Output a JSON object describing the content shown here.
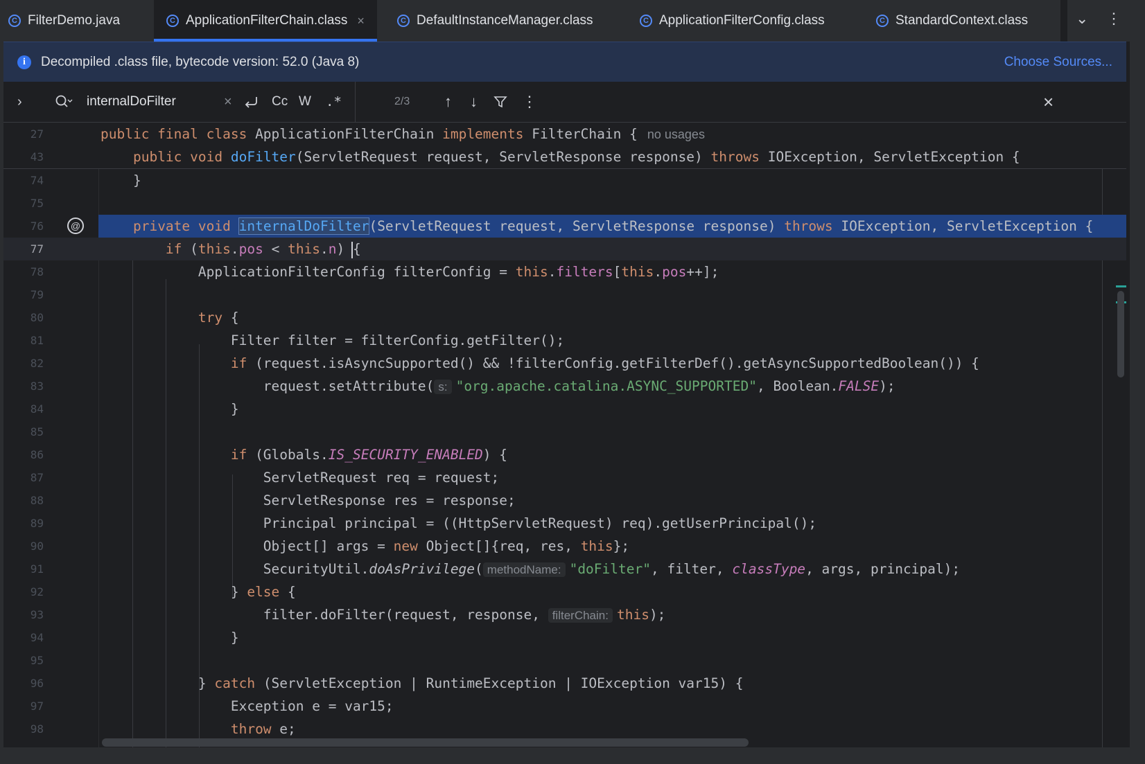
{
  "tabs": [
    {
      "label": "FilterDemo.java",
      "icon": "java-class-icon",
      "active": false
    },
    {
      "label": "ApplicationFilterChain.class",
      "icon": "class-file-icon",
      "active": true
    },
    {
      "label": "DefaultInstanceManager.class",
      "icon": "class-icon",
      "active": false
    },
    {
      "label": "ApplicationFilterConfig.class",
      "icon": "class-file-icon",
      "active": false
    },
    {
      "label": "StandardContext.class",
      "icon": "class-icon",
      "active": false
    }
  ],
  "tab_close": "×",
  "banner": {
    "message": "Decompiled .class file, bytecode version: 52.0 (Java 8)",
    "link": "Choose Sources..."
  },
  "find": {
    "query": "internalDoFilter",
    "match_count": "2/3",
    "case_label": "Cc",
    "word_label": "W",
    "regex_label": ".*"
  },
  "sticky": {
    "line1_no": "27",
    "line2_no": "43",
    "no_usages": "no usages"
  },
  "code": {
    "line_numbers": [
      "74",
      "75",
      "76",
      "77",
      "78",
      "79",
      "80",
      "81",
      "82",
      "83",
      "84",
      "85",
      "86",
      "87",
      "88",
      "89",
      "90",
      "91",
      "92",
      "93",
      "94",
      "95",
      "96",
      "97",
      "98"
    ],
    "hints": {
      "s": "s:",
      "methodName": "methodName:",
      "filterChain": "filterChain:"
    }
  },
  "colors": {
    "keyword": "#cf8e6d",
    "method": "#56a8f5",
    "field": "#c77dbb",
    "string": "#6aab73",
    "selection": "#214283",
    "accent": "#3574f0"
  }
}
